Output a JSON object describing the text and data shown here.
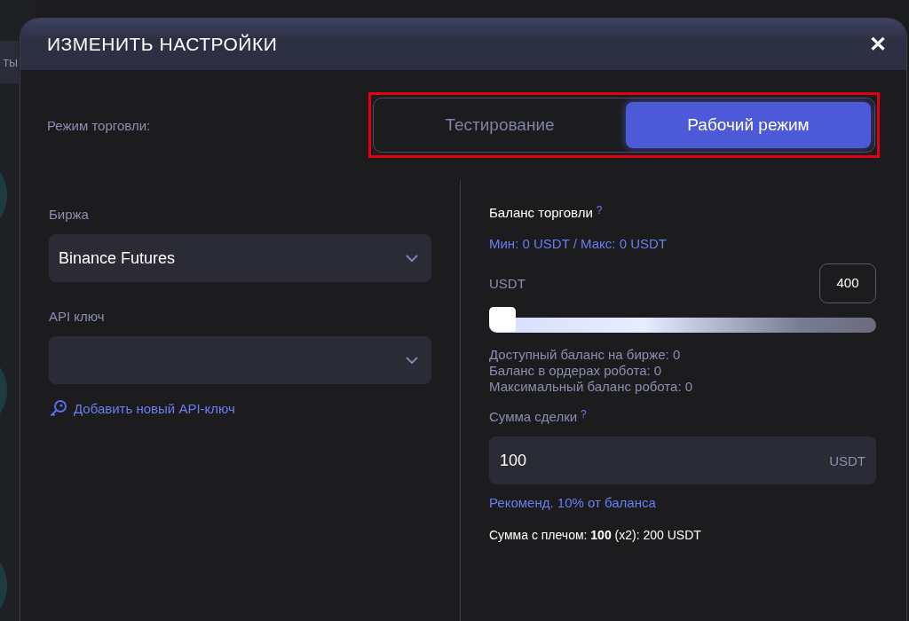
{
  "background": {
    "tab_fragment": "ты"
  },
  "dialog": {
    "title": "ИЗМЕНИТЬ НАСТРОЙКИ",
    "close": "✕"
  },
  "trading_mode": {
    "label": "Режим торговли:",
    "highlighted": true,
    "options": [
      {
        "label": "Тестирование",
        "selected": false
      },
      {
        "label": "Рабочий режим",
        "selected": true
      }
    ]
  },
  "exchange": {
    "label": "Биржа",
    "value": "Binance Futures"
  },
  "api_key": {
    "label": "API ключ",
    "add_link": "Добавить новый API-ключ"
  },
  "balance": {
    "title": "Баланс торговли",
    "help": "?",
    "range": "Мин: 0 USDT / Макс: 0 USDT",
    "unit_label": "USDT",
    "value": "400",
    "level": 0.0,
    "info": [
      "Доступный баланс на бирже: 0",
      "Баланс в ордерах робота: 0",
      "Максимальный баланс робота: 0"
    ]
  },
  "deal_amount": {
    "label": "Сумма сделки",
    "help": "?",
    "value": "100",
    "unit": "USDT",
    "hint": "Рекоменд. 10% от баланса",
    "leverage": "Сумма с плечом: **100** (x2): 200 USDT"
  }
}
